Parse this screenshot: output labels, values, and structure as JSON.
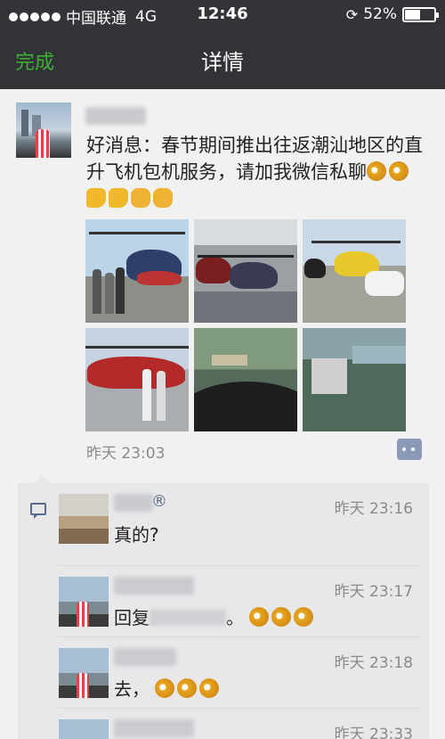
{
  "status_bar": {
    "carrier": "中国联通",
    "network": "4G",
    "time": "12:46",
    "battery": "52%",
    "battery_level": 0.52
  },
  "nav": {
    "back_label": "完成",
    "title": "详情"
  },
  "post": {
    "text": "好消息：春节期间推出往返潮汕地区的直升飞机包机服务，请加我微信私聊",
    "time": "昨天 23:03"
  },
  "comments": [
    {
      "name_suffix": "®",
      "time": "昨天 23:16",
      "text": "真的?"
    },
    {
      "time": "昨天 23:17",
      "text_prefix": "回复",
      "text_mid": "。"
    },
    {
      "time": "昨天 23:18",
      "text": "去，"
    },
    {
      "time": "昨天 23:33"
    }
  ],
  "colors": {
    "accent": "#3cb034",
    "nav_bg": "#323337",
    "link": "#586b8c"
  }
}
